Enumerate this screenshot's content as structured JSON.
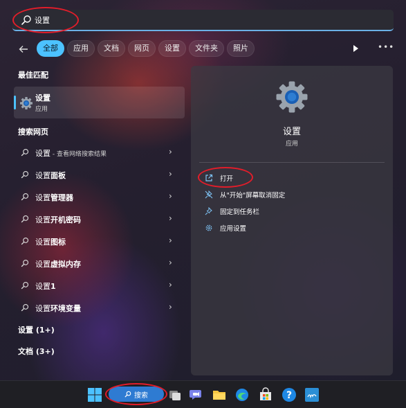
{
  "search": {
    "value": "设置"
  },
  "filters": [
    {
      "label": "全部"
    },
    {
      "label": "应用"
    },
    {
      "label": "文档"
    },
    {
      "label": "网页"
    },
    {
      "label": "设置"
    },
    {
      "label": "文件夹"
    },
    {
      "label": "照片"
    }
  ],
  "best_match": {
    "heading": "最佳匹配",
    "name": "设置",
    "type": "应用"
  },
  "web": {
    "heading": "搜索网页",
    "items": [
      {
        "prefix": "设置",
        "bold": "",
        "suffix": " - 查看网络搜索结果"
      },
      {
        "prefix": "设置",
        "bold": "面板",
        "suffix": ""
      },
      {
        "prefix": "设置",
        "bold": "管理器",
        "suffix": ""
      },
      {
        "prefix": "设置",
        "bold": "开机密码",
        "suffix": ""
      },
      {
        "prefix": "设置",
        "bold": "图标",
        "suffix": ""
      },
      {
        "prefix": "设置",
        "bold": "虚拟内存",
        "suffix": ""
      },
      {
        "prefix": "设置",
        "bold": "1",
        "suffix": ""
      },
      {
        "prefix": "设置",
        "bold": "环境变量",
        "suffix": ""
      }
    ]
  },
  "groups": [
    {
      "label": "设置 (1+)"
    },
    {
      "label": "文档 (3+)"
    }
  ],
  "panel": {
    "title": "设置",
    "subtitle": "应用",
    "actions": [
      {
        "label": "打开",
        "icon": "open-external-icon"
      },
      {
        "label": "从\"开始\"屏幕取消固定",
        "icon": "unpin-icon"
      },
      {
        "label": "固定到任务栏",
        "icon": "pin-icon"
      },
      {
        "label": "应用设置",
        "icon": "gear-icon"
      }
    ]
  },
  "taskbar": {
    "search_label": "搜索"
  },
  "colors": {
    "accent": "#4cc2ff",
    "annotation": "#e21d2a"
  }
}
